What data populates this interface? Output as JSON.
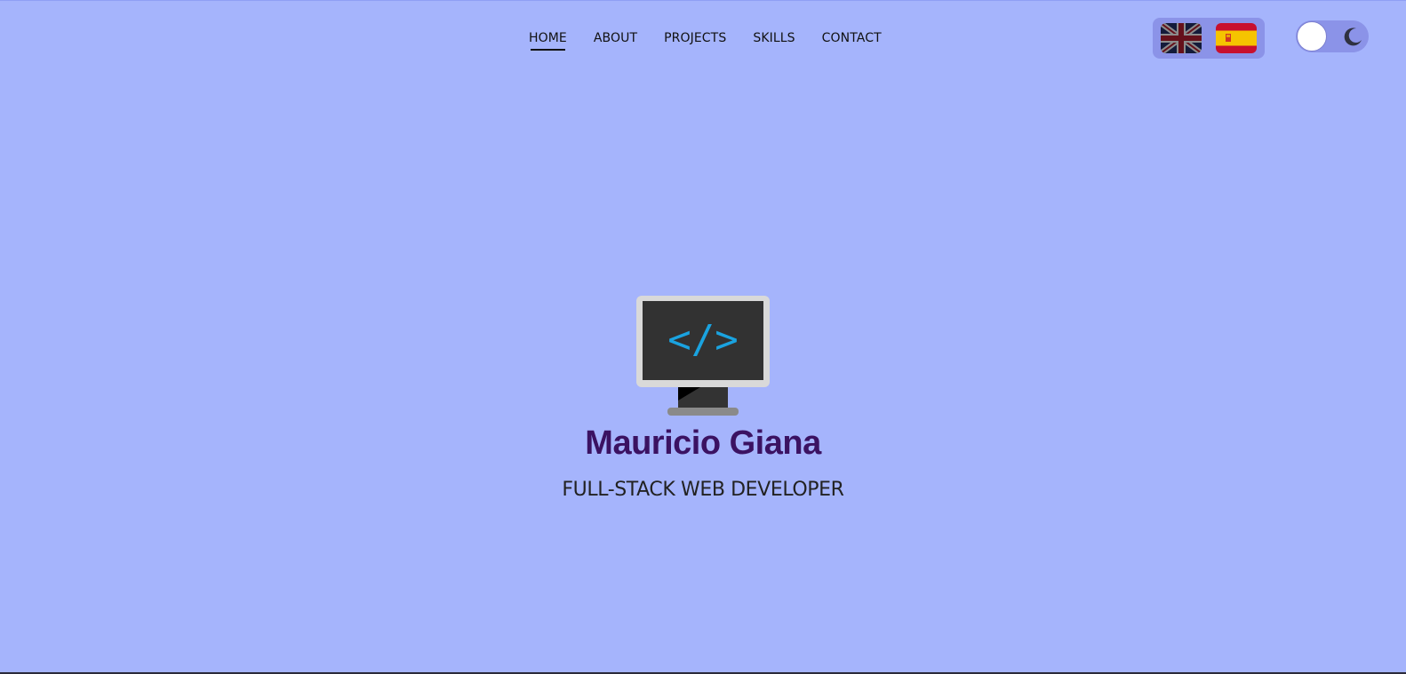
{
  "nav": {
    "links": [
      {
        "label": "HOME",
        "active": true
      },
      {
        "label": "ABOUT",
        "active": false
      },
      {
        "label": "PROJECTS",
        "active": false
      },
      {
        "label": "SKILLS",
        "active": false
      },
      {
        "label": "CONTACT",
        "active": false
      }
    ]
  },
  "language_switcher": {
    "options": [
      {
        "icon": "uk-flag-icon"
      },
      {
        "icon": "spain-flag-icon"
      }
    ]
  },
  "theme_toggle": {
    "icon": "moon-icon",
    "state": "light"
  },
  "hero": {
    "icon": "monitor-code-icon",
    "code_symbol": "</>",
    "name": "Mauricio Giana",
    "role": "FULL-STACK WEB DEVELOPER"
  },
  "colors": {
    "background": "#a5b4fc",
    "name": "#3b1262",
    "code_symbol": "#1aa3e0",
    "control_bg": "#8b93e8"
  }
}
